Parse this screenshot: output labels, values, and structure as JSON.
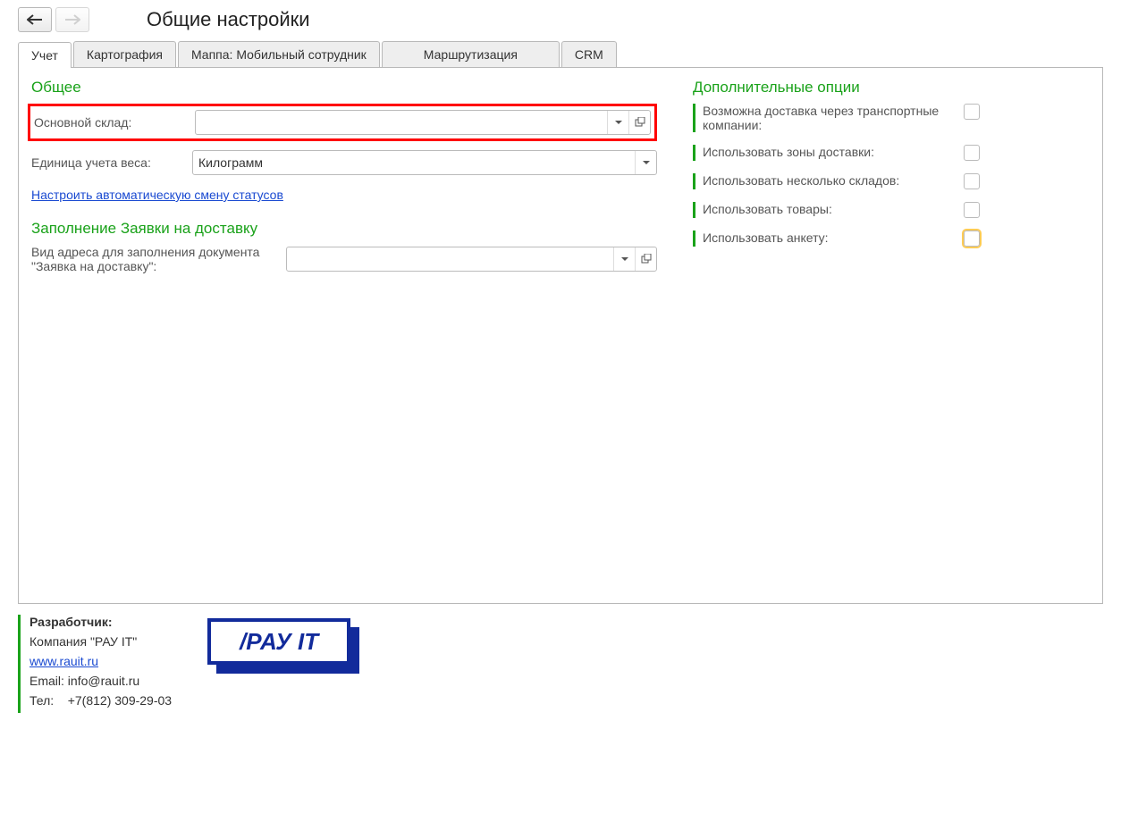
{
  "header": {
    "title": "Общие настройки"
  },
  "tabs": {
    "t0": "Учет",
    "t1": "Картография",
    "t2": "Маппа: Мобильный сотрудник",
    "t3": "Маршрутизация",
    "t4": "CRM"
  },
  "general": {
    "section_title": "Общее",
    "main_warehouse_label": "Основной склад:",
    "main_warehouse_value": "",
    "weight_unit_label": "Единица учета веса:",
    "weight_unit_value": "Килограмм",
    "status_link": "Настроить автоматическую смену статусов"
  },
  "fill": {
    "section_title": "Заполнение Заявки на доставку",
    "address_label": "Вид адреса для заполнения документа \"Заявка на доставку\":",
    "address_value": ""
  },
  "options": {
    "section_title": "Дополнительные опции",
    "o0": "Возможна доставка через транспортные компании:",
    "o1": "Использовать зоны доставки:",
    "o2": "Использовать несколько складов:",
    "o3": "Использовать товары:",
    "o4": "Использовать анкету:"
  },
  "footer": {
    "dev_label": "Разработчик:",
    "company": "Компания \"РАУ IT\"",
    "url": "www.rauit.ru",
    "email_label": "Email:",
    "email_value": "info@rauit.ru",
    "phone_label": "Тел:",
    "phone_value": "+7(812) 309-29-03",
    "logo_text": "/РАУ IT"
  }
}
